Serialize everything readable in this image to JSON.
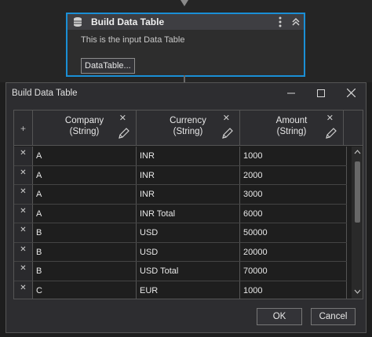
{
  "activity": {
    "title": "Build Data Table",
    "description": "This is the input Data Table",
    "button_label": "DataTable..."
  },
  "dialog": {
    "title": "Build Data Table",
    "ok_label": "OK",
    "cancel_label": "Cancel"
  },
  "table": {
    "columns": [
      {
        "name": "Company",
        "type": "(String)"
      },
      {
        "name": "Currency",
        "type": "(String)"
      },
      {
        "name": "Amount",
        "type": "(String)"
      }
    ],
    "rows": [
      [
        "A",
        "INR",
        "1000"
      ],
      [
        "A",
        "INR",
        "2000"
      ],
      [
        "A",
        "INR",
        "3000"
      ],
      [
        "A",
        "INR Total",
        "6000"
      ],
      [
        "B",
        "USD",
        "50000"
      ],
      [
        "B",
        "USD",
        "20000"
      ],
      [
        "B",
        "USD Total",
        "70000"
      ],
      [
        "C",
        "EUR",
        "1000"
      ]
    ]
  },
  "colors": {
    "accent": "#1a8fd6",
    "background": "#1e1e1e",
    "panel": "#2d2d30"
  }
}
